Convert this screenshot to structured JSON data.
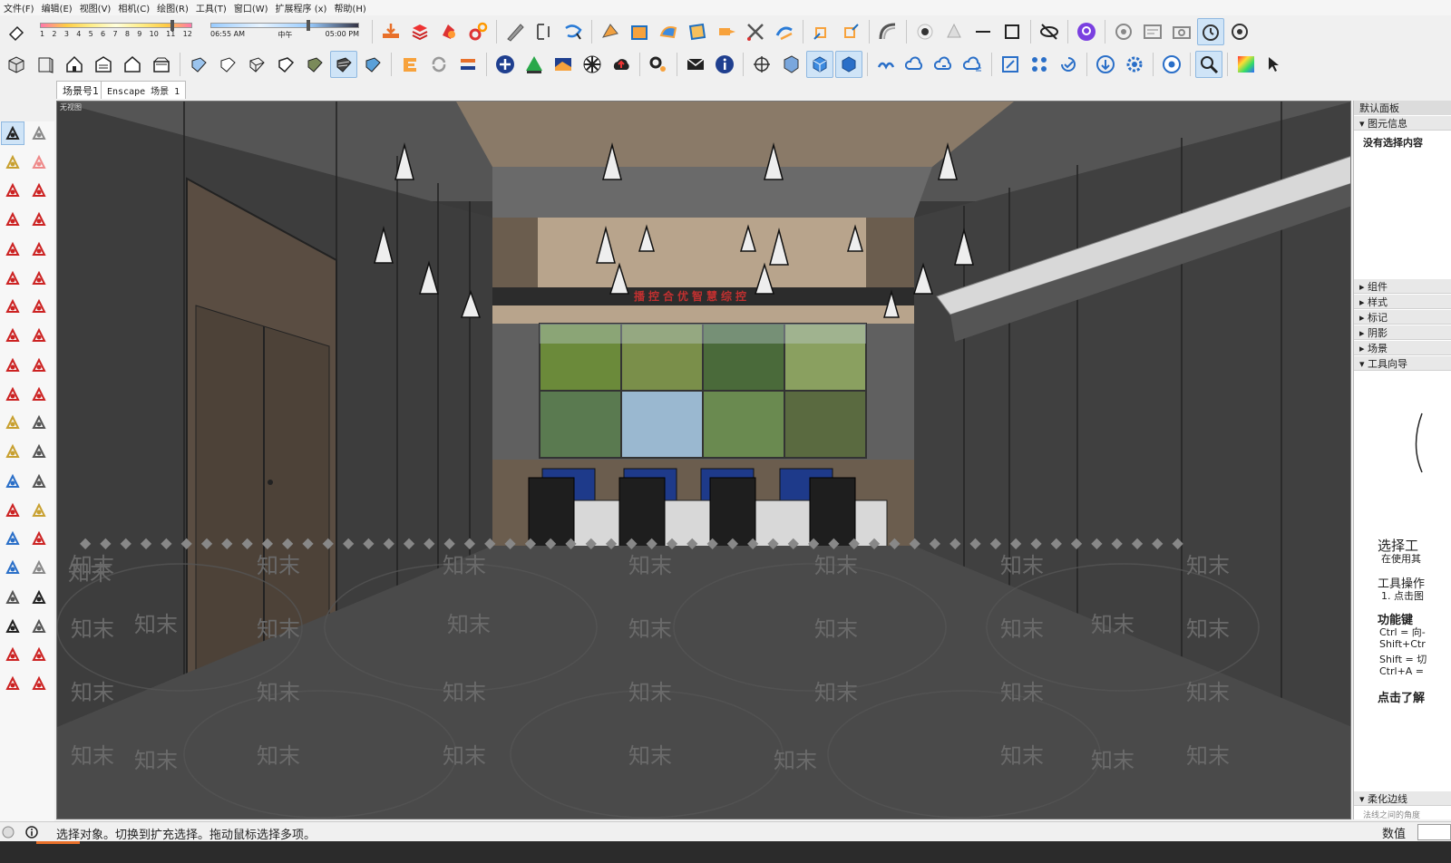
{
  "menu": [
    "文件(F)",
    "编辑(E)",
    "视图(V)",
    "相机(C)",
    "绘图(R)",
    "工具(T)",
    "窗口(W)",
    "扩展程序 (x)",
    "帮助(H)"
  ],
  "shadow": {
    "months": [
      "1",
      "2",
      "3",
      "4",
      "5",
      "6",
      "7",
      "8",
      "9",
      "10",
      "11",
      "12"
    ],
    "time_start": "06:55 AM",
    "time_mid": "中午",
    "time_end": "05:00 PM"
  },
  "scene_tabs": [
    "场景号1",
    "Enscape 场景 1"
  ],
  "viewport": {
    "label": "无视图",
    "banner": "播控合优智慧综控"
  },
  "watermark": "知末",
  "right_panel": {
    "title": "默认面板",
    "entity_info": "图元信息",
    "nothing_selected": "没有选择内容",
    "sections": [
      "组件",
      "样式",
      "标记",
      "阴影",
      "场景",
      "工具向导"
    ],
    "guide": {
      "heading": "选择工",
      "sub": "在使用其",
      "ops_title": "工具操作",
      "ops_item": "1. 点击图",
      "keys_title": "功能键",
      "key1": "Ctrl = 向-",
      "key2": "Shift+Ctr",
      "key3": "Shift = 切",
      "key4": "Ctrl+A =",
      "learn_more": "点击了解"
    },
    "soften": "柔化边线",
    "soften_sub": "法线之间的角度"
  },
  "status": {
    "text": "选择对象。切换到扩充选择。拖动鼠标选择多项。",
    "measure_label": "数值"
  },
  "colors": {
    "accent": "#3c8be0",
    "panel_bg": "#f0f0f0",
    "viewport_bg": "#3a3a3a"
  }
}
